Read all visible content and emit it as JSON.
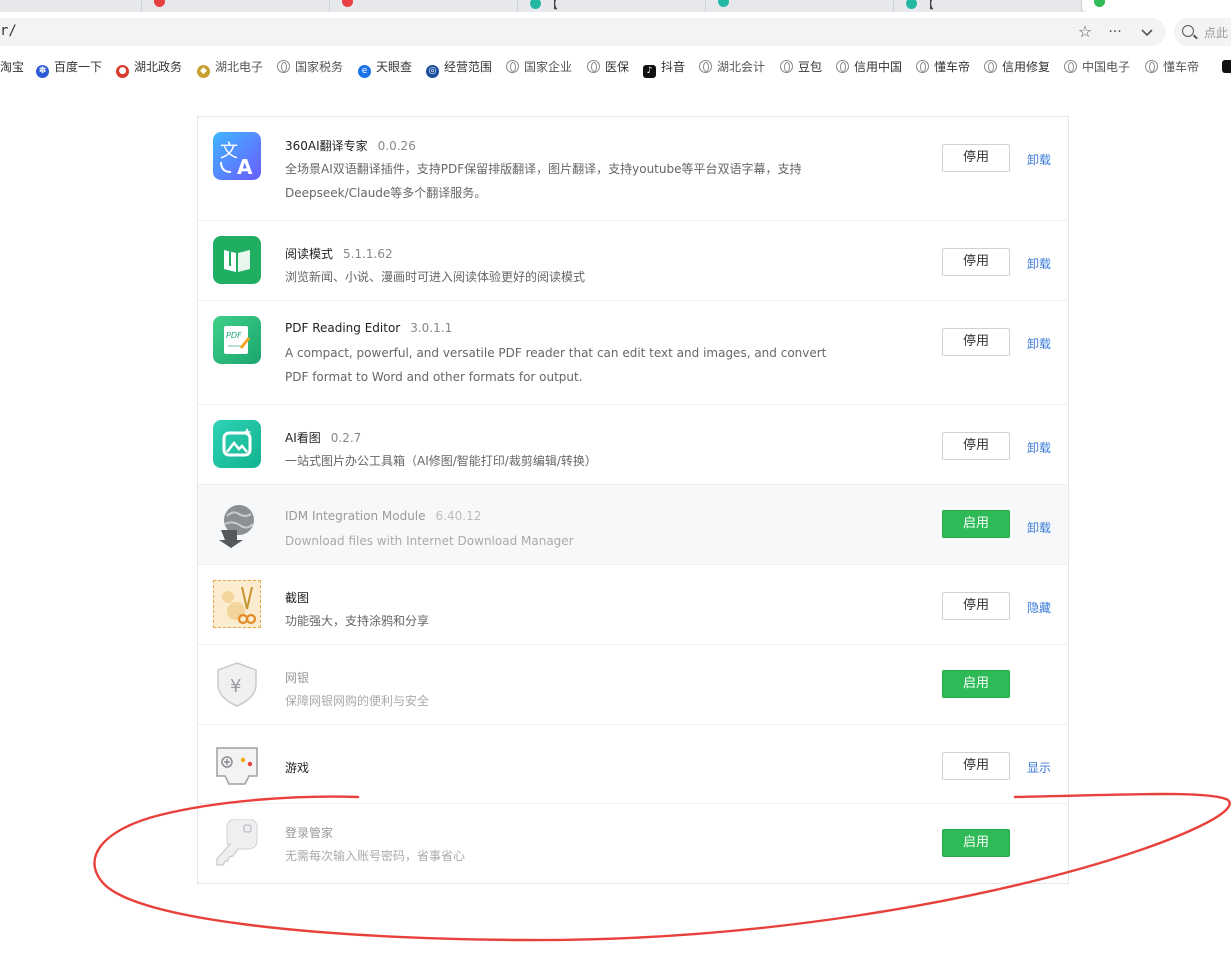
{
  "tabs": [
    {
      "label": "",
      "color": "#e84040"
    },
    {
      "label": "",
      "color": "#e84040"
    },
    {
      "label": "",
      "color": "#e84040"
    },
    {
      "label": "【",
      "color": "#22b8a3"
    },
    {
      "label": "",
      "color": "#22b8a3"
    },
    {
      "label": "【",
      "color": "#22b8a3"
    },
    {
      "label": "",
      "color": "#2ebb57"
    }
  ],
  "address": {
    "url": "r/"
  },
  "search": {
    "placeholder": "点此"
  },
  "bookmarks": [
    {
      "label": "淘宝",
      "color": "#ff6a00",
      "icon": ""
    },
    {
      "label": "百度一下",
      "color": "#2f5bd8",
      "icon": "百"
    },
    {
      "label": "湖北政务",
      "color": "#d83a2f",
      "icon": "鄂"
    },
    {
      "label": "湖北电子",
      "color": "#c8a030",
      "icon": "徽"
    },
    {
      "label": "国家税务",
      "color": "",
      "icon": "globe"
    },
    {
      "label": "天眼查",
      "color": "#1a73e8",
      "icon": "e"
    },
    {
      "label": "经营范围",
      "color": "#1c4f9c",
      "icon": "经"
    },
    {
      "label": "国家企业",
      "color": "",
      "icon": "globe"
    },
    {
      "label": "医保",
      "color": "",
      "icon": "globe"
    },
    {
      "label": "抖音",
      "color": "#111111",
      "icon": "♪"
    },
    {
      "label": "湖北会计",
      "color": "",
      "icon": "globe"
    },
    {
      "label": "豆包",
      "color": "",
      "icon": "globe"
    },
    {
      "label": "信用中国",
      "color": "",
      "icon": "globe"
    },
    {
      "label": "懂车帝",
      "color": "",
      "icon": "globe"
    },
    {
      "label": "信用修复",
      "color": "",
      "icon": "globe"
    },
    {
      "label": "中国电子",
      "color": "",
      "icon": "globe"
    },
    {
      "label": "懂车帝",
      "color": "",
      "icon": "globe"
    }
  ],
  "extensions": [
    {
      "name": "360AI翻译专家",
      "version": "0.0.26",
      "desc_line1": "全场景AI双语翻译插件，支持PDF保留排版翻译，图片翻译，支持youtube等平台双语字幕，支持",
      "desc_line2": "Deepseek/Claude等多个翻译服务。",
      "button": "停用",
      "link": "卸载",
      "state": "enabled",
      "icon": "translate-icon"
    },
    {
      "name": "阅读模式",
      "version": "5.1.1.62",
      "desc_line1": "浏览新闻、小说、漫画时可进入阅读体验更好的阅读模式",
      "desc_line2": "",
      "button": "停用",
      "link": "卸载",
      "state": "enabled",
      "icon": "book-icon"
    },
    {
      "name": "PDF Reading Editor",
      "version": "3.0.1.1",
      "desc_line1": "A compact, powerful, and versatile PDF reader that can edit text and images, and convert",
      "desc_line2": "PDF format to Word and other formats for output.",
      "button": "停用",
      "link": "卸载",
      "state": "enabled",
      "icon": "pdf-icon"
    },
    {
      "name": "AI看图",
      "version": "0.2.7",
      "desc_line1": "一站式图片办公工具箱（AI修图/智能打印/裁剪编辑/转换）",
      "desc_line2": "",
      "button": "停用",
      "link": "卸载",
      "state": "enabled",
      "icon": "image-icon"
    },
    {
      "name": "IDM Integration Module",
      "version": "6.40.12",
      "desc_line1": "Download files with Internet Download Manager",
      "desc_line2": "",
      "button": "启用",
      "link": "卸载",
      "state": "disabled",
      "icon": "globe-download-icon"
    },
    {
      "name": "截图",
      "version": "",
      "desc_line1": "功能强大，支持涂鸦和分享",
      "desc_line2": "",
      "button": "停用",
      "link": "隐藏",
      "state": "enabled",
      "icon": "scissors-icon"
    },
    {
      "name": "网银",
      "version": "",
      "desc_line1": "保障网银网购的便利与安全",
      "desc_line2": "",
      "button": "启用",
      "link": "",
      "state": "gray",
      "icon": "shield-yen-icon"
    },
    {
      "name": "游戏",
      "version": "",
      "desc_line1": "",
      "desc_line2": "",
      "button": "停用",
      "link": "显示",
      "state": "enabled",
      "icon": "gamepad-icon"
    },
    {
      "name": "登录管家",
      "version": "",
      "desc_line1": "无需每次输入账号密码，省事省心",
      "desc_line2": "",
      "button": "启用",
      "link": "",
      "state": "gray",
      "icon": "key-icon"
    }
  ],
  "colors": {
    "enable_green": "#2ebb57",
    "link_blue": "#3a7bd5",
    "annotation_red": "#e8413c"
  }
}
